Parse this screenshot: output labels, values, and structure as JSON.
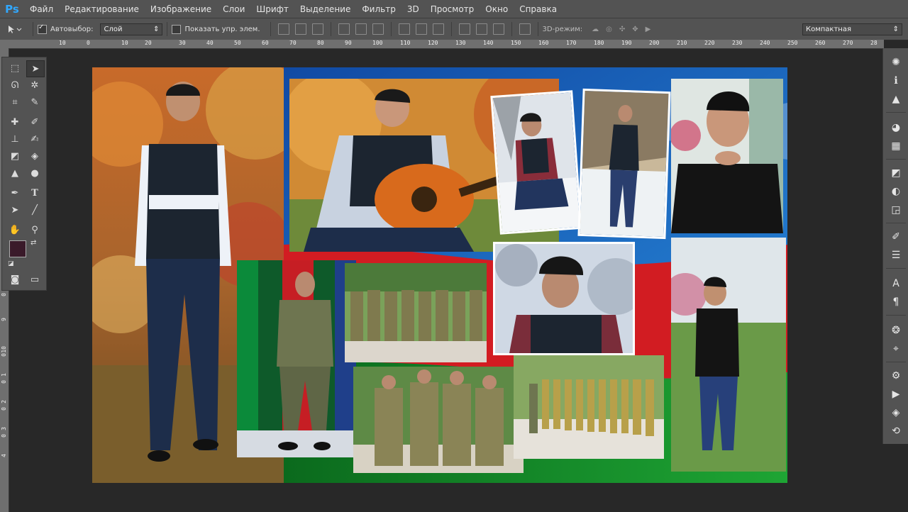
{
  "app": {
    "logo": "Ps"
  },
  "menu": [
    "Файл",
    "Редактирование",
    "Изображение",
    "Слои",
    "Шрифт",
    "Выделение",
    "Фильтр",
    "3D",
    "Просмотр",
    "Окно",
    "Справка"
  ],
  "options": {
    "autoselect_label": "Автовыбор:",
    "autoselect_value": "Слой",
    "show_controls_label": "Показать упр. элем.",
    "mode3d_label": "3D-режим:",
    "workspace_value": "Компактная"
  },
  "ruler_top": [
    "10",
    "0",
    "10",
    "20",
    "30",
    "40",
    "50",
    "60",
    "70",
    "80",
    "90",
    "100",
    "110",
    "120",
    "130",
    "140",
    "150",
    "160",
    "170",
    "180",
    "190",
    "200",
    "210",
    "220",
    "230",
    "240",
    "250",
    "260",
    "270",
    "28"
  ],
  "ruler_left": [
    "0",
    "9",
    "10",
    "0",
    "1",
    "0",
    "2",
    "0",
    "3",
    "0",
    "4"
  ],
  "colors": {
    "foreground": "#3a1a2a",
    "background": "#ffffff"
  },
  "icons": {
    "move": "move-icon",
    "marquee": "marquee-icon",
    "lasso": "lasso-icon",
    "wand": "magic-wand-icon",
    "crop": "crop-icon",
    "eyedropper": "eyedropper-icon",
    "heal": "healing-brush-icon",
    "brush": "brush-icon",
    "stamp": "clone-stamp-icon",
    "history": "history-brush-icon",
    "eraser": "eraser-icon",
    "bucket": "paint-bucket-icon",
    "blur": "blur-icon",
    "dodge": "dodge-icon",
    "pen": "pen-icon",
    "type": "type-icon",
    "select": "path-select-icon",
    "line": "line-icon",
    "hand": "hand-icon",
    "zoom": "zoom-icon"
  }
}
